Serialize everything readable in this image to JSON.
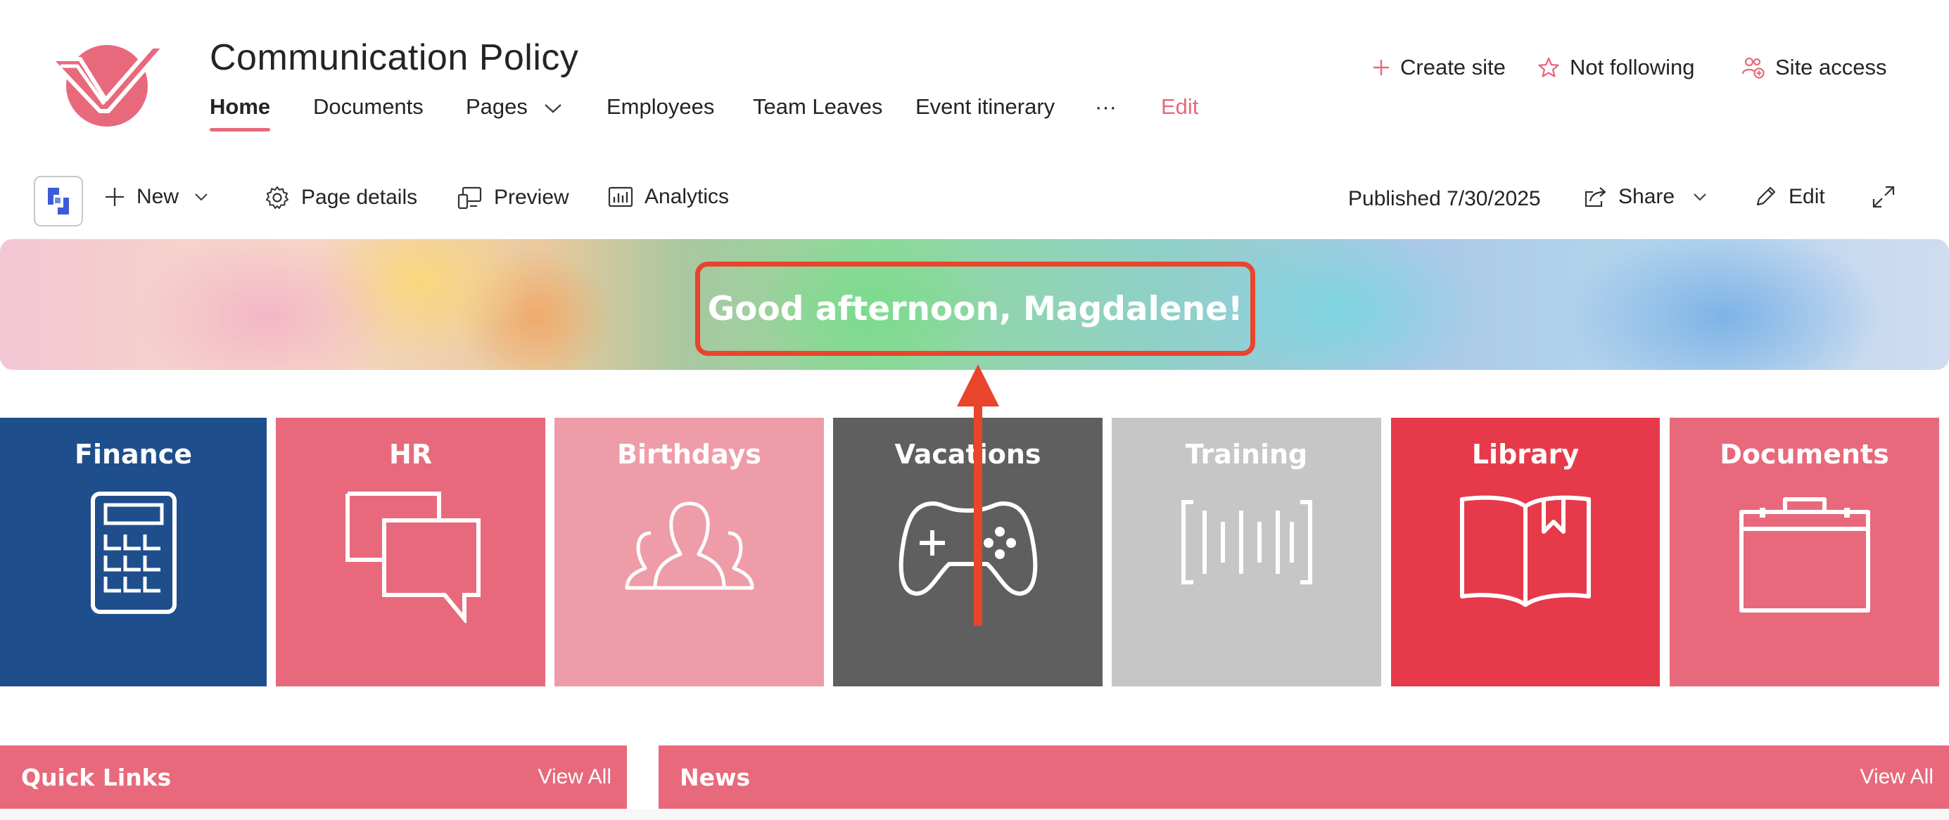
{
  "site": {
    "title": "Communication Policy",
    "nav": [
      {
        "label": "Home",
        "active": true
      },
      {
        "label": "Documents"
      },
      {
        "label": "Pages"
      },
      {
        "label": "Employees"
      },
      {
        "label": "Team Leaves"
      },
      {
        "label": "Event itinerary"
      },
      {
        "label": "···"
      },
      {
        "label": "Edit"
      }
    ],
    "actions": {
      "create_site": "Create site",
      "not_following": "Not following",
      "site_access": "Site access"
    }
  },
  "commandbar": {
    "new": "New",
    "page_details": "Page details",
    "preview": "Preview",
    "analytics": "Analytics",
    "published": "Published 7/30/2025",
    "share": "Share",
    "edit": "Edit"
  },
  "banner": {
    "greeting": "Good afternoon, Magdalene!"
  },
  "tiles": [
    {
      "label": "Finance",
      "icon": "calculator-icon",
      "color": "#1f4e8c"
    },
    {
      "label": "HR",
      "icon": "chat-bubbles-icon",
      "color": "#e8697c"
    },
    {
      "label": "Birthdays",
      "icon": "people-group-icon",
      "color": "#ee9ca8"
    },
    {
      "label": "Vacations",
      "icon": "gamepad-icon",
      "color": "#5f5f5f"
    },
    {
      "label": "Training",
      "icon": "barcode-scan-icon",
      "color": "#c6c6c6"
    },
    {
      "label": "Library",
      "icon": "book-icon",
      "color": "#e63a4a"
    },
    {
      "label": "Documents",
      "icon": "briefcase-icon",
      "color": "#e8697c"
    }
  ],
  "sections": {
    "quick_links": {
      "title": "Quick Links",
      "link": "View All"
    },
    "news": {
      "title": "News",
      "link": "View All"
    }
  },
  "colors": {
    "accent": "#e8697c",
    "annotation": "#e8452c"
  }
}
